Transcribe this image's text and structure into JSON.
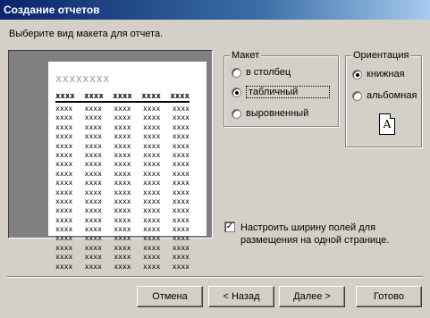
{
  "window": {
    "title": "Создание отчетов"
  },
  "prompt": "Выберите вид макета для отчета.",
  "preview": {
    "title_text": "xxxxxxxx",
    "header_cells": [
      "xxxx",
      "xxxx",
      "xxxx",
      "xxxx",
      "xxxx"
    ],
    "row_cell": "xxxx",
    "row_count": 18
  },
  "layout_group": {
    "legend": "Макет",
    "options": [
      {
        "label": "в столбец",
        "selected": false
      },
      {
        "label": "табличный",
        "selected": true
      },
      {
        "label": "выровненный",
        "selected": false
      }
    ]
  },
  "orientation_group": {
    "legend": "Ориентация",
    "options": [
      {
        "label": "книжная",
        "selected": true
      },
      {
        "label": "альбомная",
        "selected": false
      }
    ],
    "icon_letter": "A"
  },
  "fit_checkbox": {
    "checked": true,
    "label": "Настроить ширину полей для размещения на одной странице."
  },
  "buttons": {
    "cancel": "Отмена",
    "back": "< Назад",
    "next": "Далее >",
    "finish": "Готово"
  }
}
